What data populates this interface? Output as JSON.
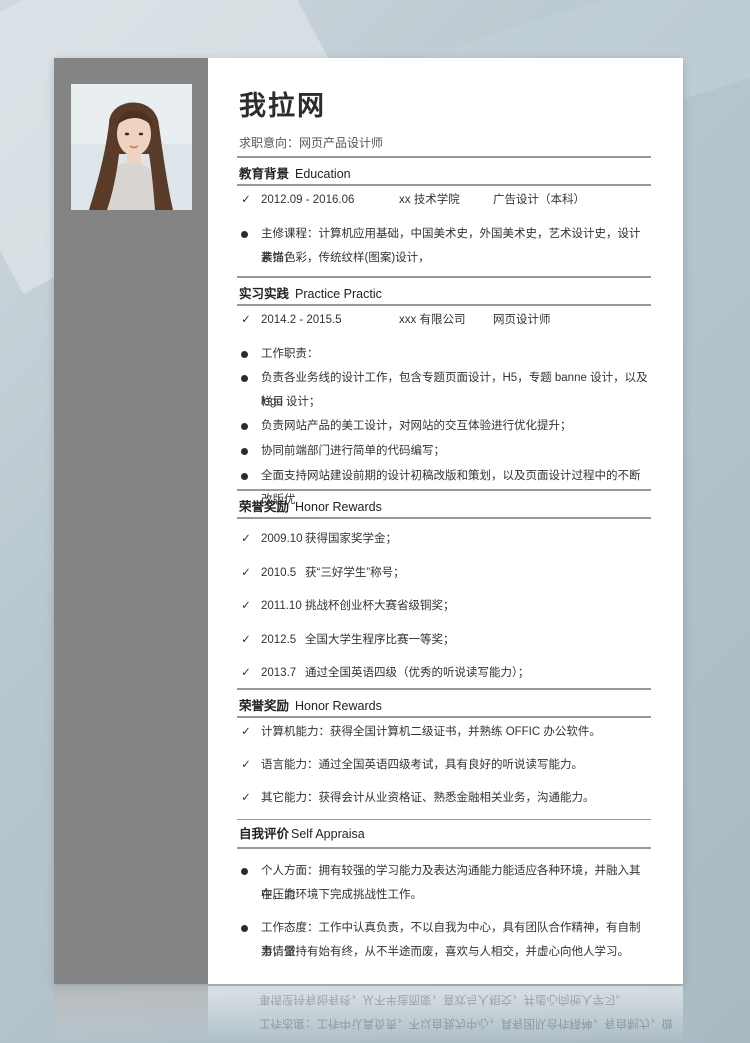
{
  "header": {
    "name": "我拉网",
    "objective": "求职意向：网页产品设计师"
  },
  "education": {
    "title_cn": "教育背景",
    "title_en": "Education",
    "entry": {
      "period": "2012.09 - 2016.06",
      "school": "xx 技术学院",
      "major": "广告设计（本科）"
    },
    "courses_line1": "主修课程：计算机应用基础，中国美术史，外国美术史，艺术设计史，设计素描，",
    "courses_line2": "装饰色彩，传统纹样(图案)设计，"
  },
  "internship": {
    "title_cn": "实习实践",
    "title_en": "Practice Practic",
    "entry": {
      "period": "2014.2 - 2015.5",
      "company": "xxx 有限公司",
      "role": "网页设计师"
    },
    "duties_label": "工作职责：",
    "duty1_line1": "负责各业务线的设计工作，包含专题页面设计，H5，专题 banne 设计，以及栏目",
    "duty1_line2": "logo 设计；",
    "duty2": "负责网站产品的美工设计，对网站的交互体验进行优化提升；",
    "duty3": "协同前端部门进行简单的代码编写；",
    "duty4": "全面支持网站建设前期的设计初稿改版和策划，以及页面设计过程中的不断改版优"
  },
  "honors": {
    "title_cn": "荣誉奖励",
    "title_en": "Honor Rewards",
    "items": [
      {
        "date": "2009.10",
        "text": "获得国家奖学金；"
      },
      {
        "date": "2010.5",
        "text": "获“三好学生”称号；"
      },
      {
        "date": "2011.10",
        "text": "挑战杯创业杯大赛省级铜奖；"
      },
      {
        "date": "2012.5",
        "text": "全国大学生程序比赛一等奖；"
      },
      {
        "date": "2013.7",
        "text": "通过全国英语四级（优秀的听说读写能力）；"
      }
    ]
  },
  "skills": {
    "title_cn": "荣誉奖励",
    "title_en": "Honor Rewards",
    "items": [
      "计算机能力：获得全国计算机二级证书，并熟练 OFFIC 办公软件。",
      "语言能力：通过全国英语四级考试，具有良好的听说读写能力。",
      "其它能力：获得会计从业资格证、熟悉金融相关业务，沟通能力。"
    ]
  },
  "self_eval": {
    "title_cn": "自我评价",
    "title_en": "Self Appraisa",
    "personal_line1": "个人方面：拥有较强的学习能力及表达沟通能力能适应各种环境，并融入其中，能",
    "personal_line2": "在压力环境下完成挑战性工作。",
    "attitude_line1": "工作态度：工作中认真负责，不以自我为中心，具有团队合作精神，有自制力，做",
    "attitude_line2": "事情坚持有始有终，从不半途而废，喜欢与人相交，并虚心向他人学习。"
  },
  "icons": {
    "check": "✓",
    "bullet": "●"
  }
}
